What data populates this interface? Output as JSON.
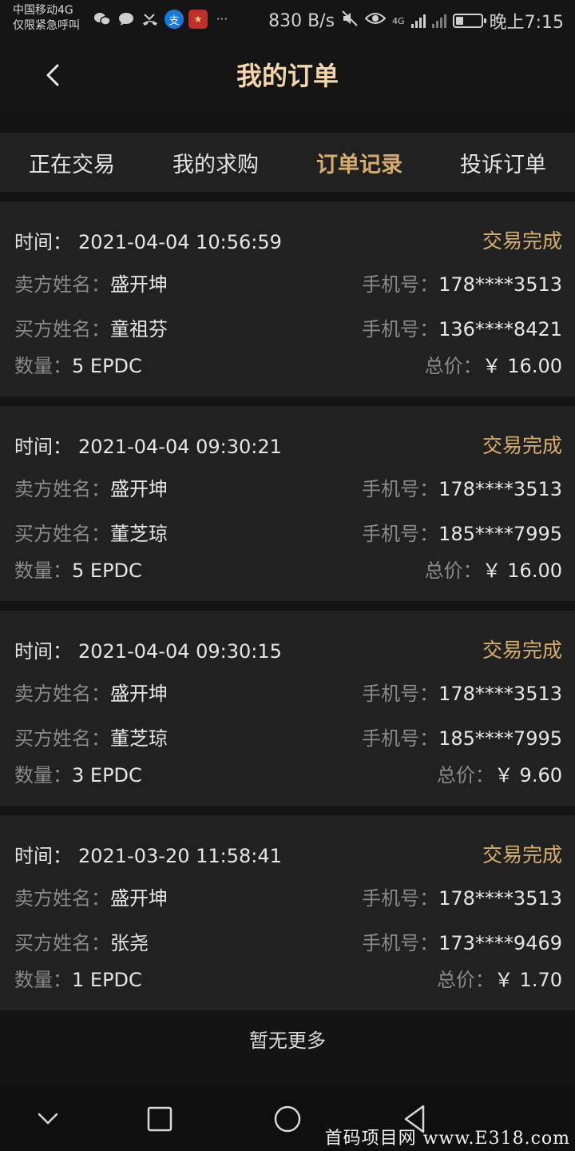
{
  "status_bar": {
    "carrier_line1": "中国移动4G",
    "carrier_line2": "仅限紧急呼叫",
    "more": "···",
    "net_speed": "830 B/s",
    "network_badge": "4G",
    "time": "晚上7:15",
    "battery_level": 0.3,
    "app_icons": [
      "wechat-icon",
      "message-icon",
      "missed-call-icon",
      "alipay-icon",
      "app-icon"
    ]
  },
  "header": {
    "title": "我的订单",
    "back_icon": "chevron-left-icon"
  },
  "tabs": [
    {
      "label": "正在交易",
      "active": false
    },
    {
      "label": "我的求购",
      "active": false
    },
    {
      "label": "订单记录",
      "active": true
    },
    {
      "label": "投诉订单",
      "active": false
    }
  ],
  "labels": {
    "time": "时间：",
    "seller": "卖方姓名：",
    "buyer": "买方姓名：",
    "phone": "手机号：",
    "quantity": "数量：",
    "total": "总价："
  },
  "orders": [
    {
      "time": "2021-04-04 10:56:59",
      "status": "交易完成",
      "seller_name": "盛开坤",
      "seller_phone": "178****3513",
      "buyer_name": "童祖芬",
      "buyer_phone": "136****8421",
      "quantity": "5 EPDC",
      "total": "￥ 16.00"
    },
    {
      "time": "2021-04-04 09:30:21",
      "status": "交易完成",
      "seller_name": "盛开坤",
      "seller_phone": "178****3513",
      "buyer_name": "董芝琼",
      "buyer_phone": "185****7995",
      "quantity": "5 EPDC",
      "total": "￥ 16.00"
    },
    {
      "time": "2021-04-04 09:30:15",
      "status": "交易完成",
      "seller_name": "盛开坤",
      "seller_phone": "178****3513",
      "buyer_name": "董芝琼",
      "buyer_phone": "185****7995",
      "quantity": "3 EPDC",
      "total": "￥ 9.60"
    },
    {
      "time": "2021-03-20 11:58:41",
      "status": "交易完成",
      "seller_name": "盛开坤",
      "seller_phone": "178****3513",
      "buyer_name": "张尧",
      "buyer_phone": "173****9469",
      "quantity": "1 EPDC",
      "total": "￥ 1.70"
    }
  ],
  "footer": {
    "no_more": "暂无更多"
  },
  "watermark": "首码项目网 www.E318.com",
  "colors": {
    "accent": "#d7ad6c",
    "title": "#f2d5a8",
    "background": "#141414",
    "card": "#212121"
  }
}
